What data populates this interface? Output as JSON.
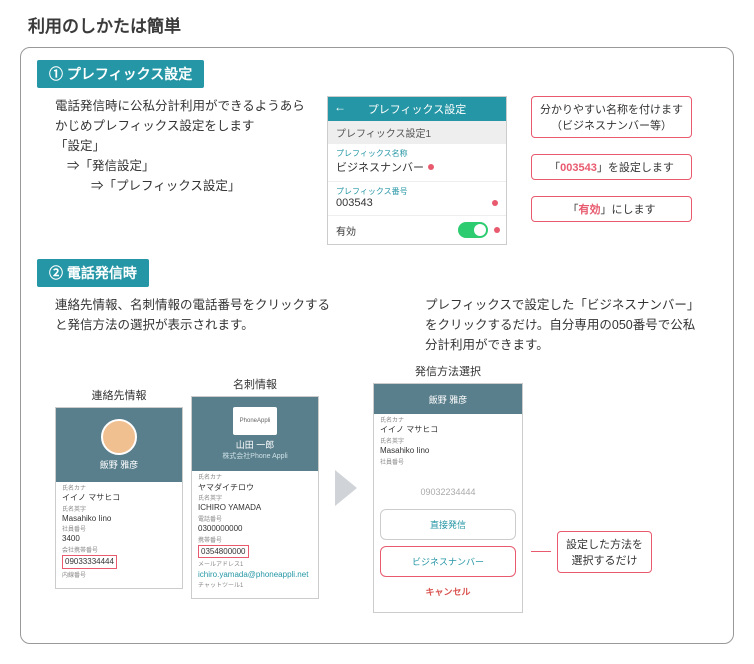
{
  "page_title": "利用のしかたは簡単",
  "section1": {
    "badge": "① プレフィックス設定",
    "desc_l1": "電話発信時に公私分計利用ができるようあらかじめプレフィックス設定をします",
    "desc_l2": "「設定」",
    "desc_l3": "⇒「発信設定」",
    "desc_l4": "⇒「プレフィックス設定」",
    "screen": {
      "header": "プレフィックス設定",
      "sub": "プレフィックス設定1",
      "name_label": "プレフィックス名称",
      "name_value": "ビジネスナンバー",
      "number_label": "プレフィックス番号",
      "number_value": "003543",
      "enable_label": "有効"
    },
    "callout1_a": "分かりやすい名称を付けます",
    "callout1_b": "（ビジネスナンバー等）",
    "callout2_a": "「",
    "callout2_num": "003543",
    "callout2_b": "」を設定します",
    "callout3_a": "「",
    "callout3_word": "有効",
    "callout3_b": "」にします"
  },
  "section2": {
    "badge": "② 電話発信時",
    "desc_left": "連絡先情報、名刺情報の電話番号をクリックすると発信方法の選択が表示されます。",
    "desc_right": "プレフィックスで設定した「ビジネスナンバー」をクリックするだけ。自分専用の050番号で公私分計利用ができます。",
    "col1_label": "連絡先情報",
    "col2_label": "名刺情報",
    "col3_label": "発信方法選択",
    "contact": {
      "name": "飯野 雅彦",
      "kana_label": "氏名カナ",
      "kana": "イイノ マサヒコ",
      "roman_label": "氏名英字",
      "roman": "Masahiko Iino",
      "emp_label": "社員番号",
      "emp": "3400",
      "phone_label": "会社携帯番号",
      "phone": "09033334444",
      "ext_label": "内線番号"
    },
    "card": {
      "name": "山田 一郎",
      "company": "株式会社Phone Appli",
      "kana_label": "氏名カナ",
      "kana": "ヤマダイチロウ",
      "roman_label": "氏名英字",
      "roman": "ICHIRO YAMADA",
      "tel_label": "電話番号",
      "tel": "0300000000",
      "mobile_label": "携帯番号",
      "mobile": "0354800000",
      "mail_label": "メールアドレス1",
      "mail": "ichiro.yamada@phoneappli.net",
      "chat_label": "チャットツール1"
    },
    "dialog": {
      "header_name": "飯野 雅彦",
      "kana_label": "氏名カナ",
      "kana": "イイノ マサヒコ",
      "roman_label": "氏名英字",
      "roman": "Masahiko Iino",
      "emp_label": "社員番号",
      "number": "09032234444",
      "opt1": "直接発信",
      "opt2": "ビジネスナンバー",
      "cancel": "キャンセル"
    },
    "callout_bottom_a": "設定した方法を",
    "callout_bottom_b": "選択するだけ"
  }
}
